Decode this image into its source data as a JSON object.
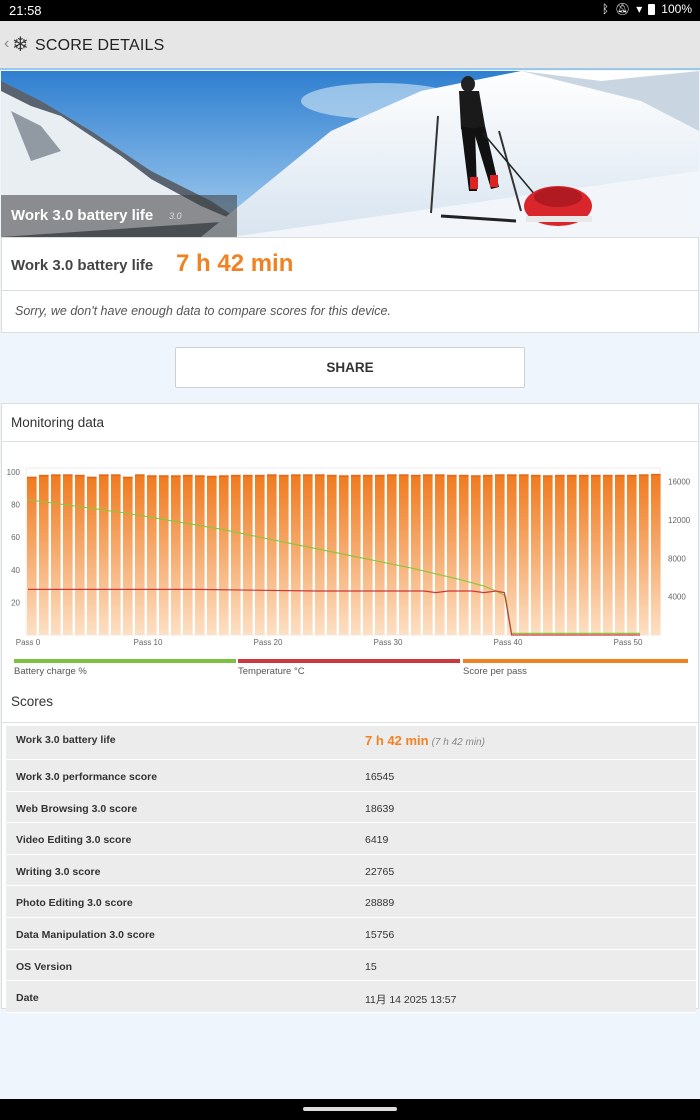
{
  "status_bar": {
    "time": "21:58",
    "battery": "100%"
  },
  "app_bar": {
    "title": "SCORE DETAILS"
  },
  "hero": {
    "caption": "Work 3.0 battery life",
    "version": "3.0"
  },
  "summary": {
    "label": "Work 3.0 battery life",
    "value": "7 h 42 min",
    "notice": "Sorry, we don't have enough data to compare scores for this device."
  },
  "share_label": "SHARE",
  "monitoring": {
    "title": "Monitoring data",
    "legend": [
      {
        "label": "Battery charge %",
        "color": "#7cc242"
      },
      {
        "label": "Temperature °C",
        "color": "#c9393d"
      },
      {
        "label": "Score per pass",
        "color": "#f08223"
      }
    ]
  },
  "chart_data": {
    "type": "bar",
    "x_ticks": [
      "Pass 0",
      "Pass 10",
      "Pass 20",
      "Pass 30",
      "Pass 40",
      "Pass 50"
    ],
    "y_left_ticks": [
      "100",
      "80",
      "60",
      "40",
      "20"
    ],
    "y_right_ticks": [
      "16000",
      "12000",
      "8000",
      "4000"
    ],
    "y_left_range": [
      0,
      100
    ],
    "y_right_range": [
      0,
      17000
    ],
    "bar_series": {
      "name": "Score per pass",
      "values": [
        16500,
        16700,
        16750,
        16750,
        16700,
        16500,
        16750,
        16750,
        16500,
        16750,
        16650,
        16650,
        16650,
        16700,
        16650,
        16600,
        16650,
        16700,
        16700,
        16700,
        16750,
        16700,
        16750,
        16750,
        16750,
        16700,
        16650,
        16700,
        16700,
        16700,
        16750,
        16750,
        16700,
        16750,
        16750,
        16700,
        16700,
        16650,
        16700,
        16750,
        16750,
        16750,
        16700,
        16650,
        16700,
        16700,
        16700,
        16700,
        16700,
        16700,
        16700,
        16750,
        16800
      ]
    },
    "battery_series": {
      "name": "Battery charge %",
      "points": [
        [
          0,
          83
        ],
        [
          4,
          79
        ],
        [
          8,
          75
        ],
        [
          12,
          70
        ],
        [
          16,
          65
        ],
        [
          20,
          59
        ],
        [
          24,
          53
        ],
        [
          28,
          47
        ],
        [
          32,
          41
        ],
        [
          36,
          34
        ],
        [
          38,
          30
        ],
        [
          39,
          27
        ],
        [
          39.8,
          24
        ],
        [
          40.3,
          1
        ],
        [
          51,
          1
        ]
      ]
    },
    "temperature_series": {
      "name": "Temperature °C",
      "points": [
        [
          0,
          28
        ],
        [
          14,
          28
        ],
        [
          24,
          27
        ],
        [
          33,
          27
        ],
        [
          34,
          26
        ],
        [
          35,
          27
        ],
        [
          37,
          27
        ],
        [
          38,
          26
        ],
        [
          39,
          27
        ],
        [
          39.7,
          26
        ],
        [
          40.3,
          0
        ],
        [
          51,
          0
        ]
      ]
    }
  },
  "scores": {
    "title": "Scores",
    "battery_life": {
      "label": "Work 3.0 battery life",
      "value": "7 h 42 min",
      "sub": "(7 h 42 min)"
    },
    "rows": [
      {
        "label": "Work 3.0 performance score",
        "value": "16545"
      },
      {
        "label": "Web Browsing 3.0 score",
        "value": "18639"
      },
      {
        "label": "Video Editing 3.0 score",
        "value": "6419"
      },
      {
        "label": "Writing 3.0 score",
        "value": "22765"
      },
      {
        "label": "Photo Editing 3.0 score",
        "value": "28889"
      },
      {
        "label": "Data Manipulation 3.0 score",
        "value": "15756"
      },
      {
        "label": "OS Version",
        "value": "15"
      },
      {
        "label": "Date",
        "value": "11月 14 2025 13:57"
      }
    ]
  }
}
